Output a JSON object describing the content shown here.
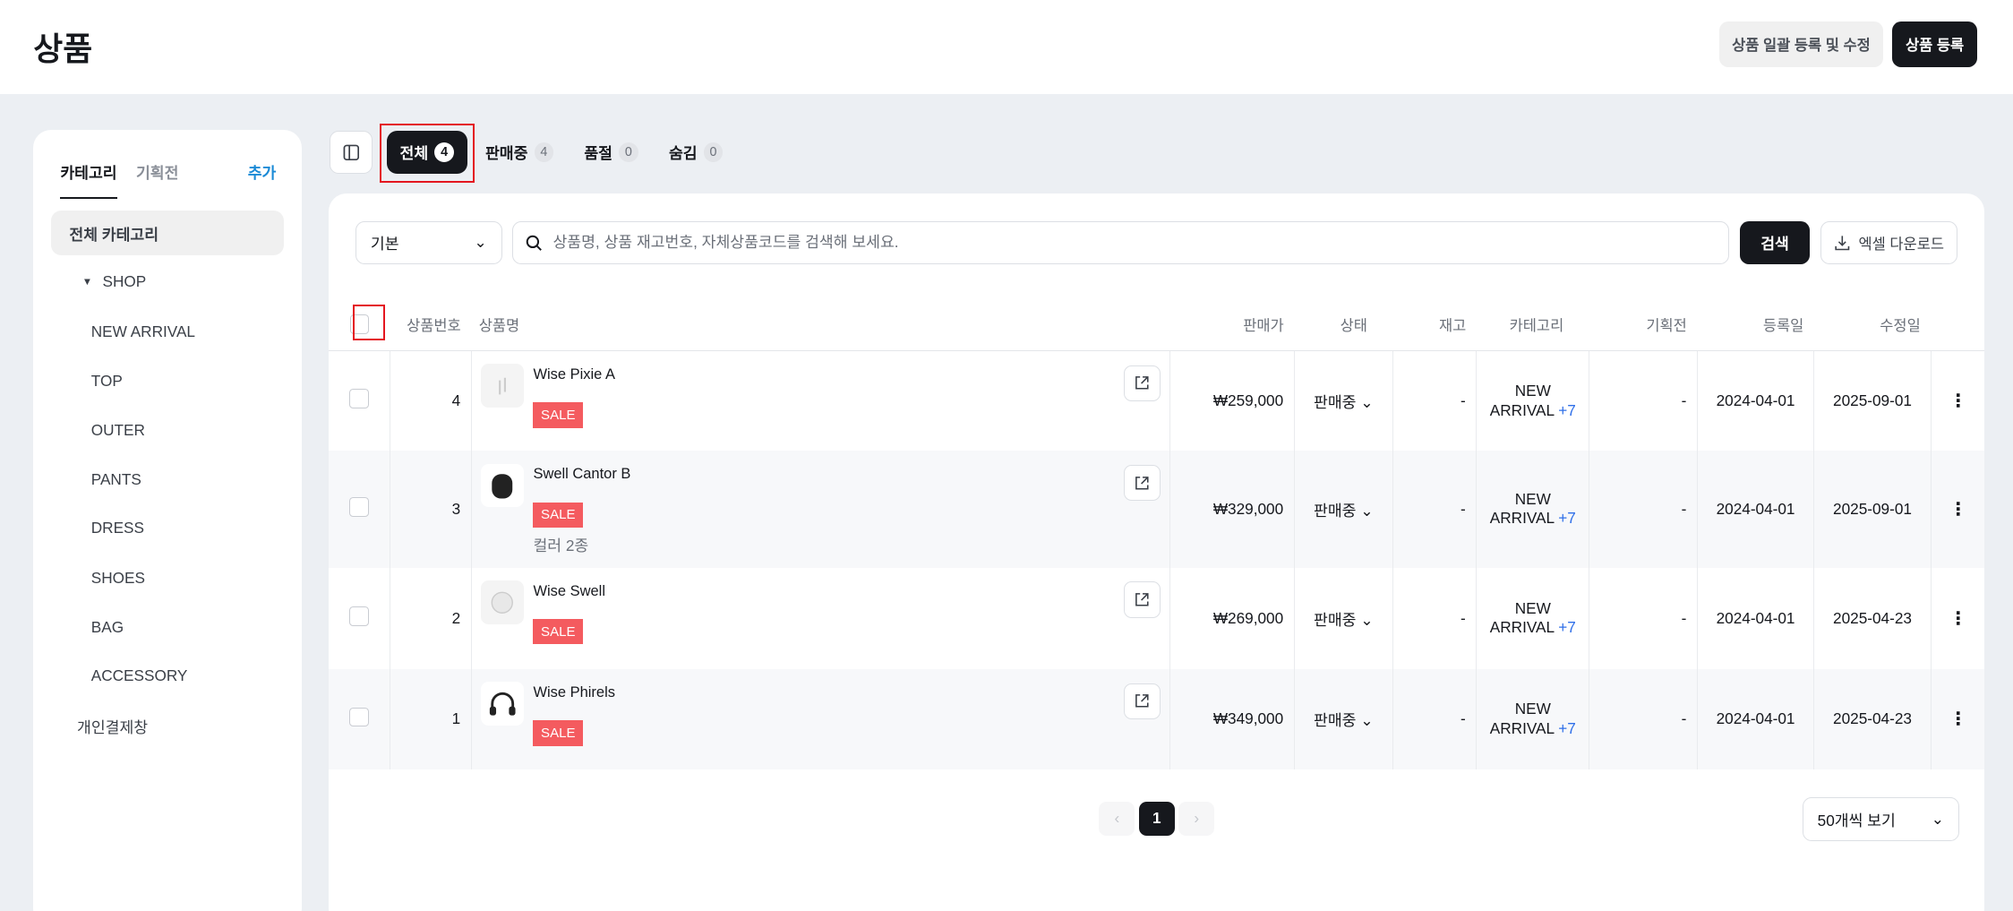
{
  "header": {
    "title": "상품",
    "bulk_button": "상품 일괄 등록 및 수정",
    "add_button": "상품 등록"
  },
  "sidebar": {
    "tabs": [
      "카테고리",
      "기획전"
    ],
    "add_link": "추가",
    "items": [
      {
        "label": "전체 카테고리"
      },
      {
        "label": "SHOP"
      },
      {
        "label": "NEW ARRIVAL"
      },
      {
        "label": "TOP"
      },
      {
        "label": "OUTER"
      },
      {
        "label": "PANTS"
      },
      {
        "label": "DRESS"
      },
      {
        "label": "SHOES"
      },
      {
        "label": "BAG"
      },
      {
        "label": "ACCESSORY"
      },
      {
        "label": "개인결제창"
      }
    ]
  },
  "tabs": [
    {
      "label": "전체",
      "count": "4"
    },
    {
      "label": "판매중",
      "count": "4"
    },
    {
      "label": "품절",
      "count": "0"
    },
    {
      "label": "숨김",
      "count": "0"
    }
  ],
  "filter": {
    "select": "기본",
    "search_placeholder": "상품명, 상품 재고번호, 자체상품코드를 검색해 보세요.",
    "search_button": "검색",
    "excel_button": "엑셀 다운로드"
  },
  "table": {
    "headers": [
      "상품번호",
      "상품명",
      "판매가",
      "상태",
      "재고",
      "카테고리",
      "기획전",
      "등록일",
      "수정일"
    ],
    "rows": [
      {
        "no": "4",
        "name": "Wise Pixie A",
        "badge": "SALE",
        "option": "",
        "price": "₩259,000",
        "status": "판매중",
        "stock": "-",
        "cat1": "NEW",
        "cat2": "ARRIVAL",
        "cat_more": "+7",
        "promo": "-",
        "created": "2024-04-01",
        "updated": "2025-09-01"
      },
      {
        "no": "3",
        "name": "Swell Cantor B",
        "badge": "SALE",
        "option": "컬러 2종",
        "price": "₩329,000",
        "status": "판매중",
        "stock": "-",
        "cat1": "NEW",
        "cat2": "ARRIVAL",
        "cat_more": "+7",
        "promo": "-",
        "created": "2024-04-01",
        "updated": "2025-09-01"
      },
      {
        "no": "2",
        "name": "Wise Swell",
        "badge": "SALE",
        "option": "",
        "price": "₩269,000",
        "status": "판매중",
        "stock": "-",
        "cat1": "NEW",
        "cat2": "ARRIVAL",
        "cat_more": "+7",
        "promo": "-",
        "created": "2024-04-01",
        "updated": "2025-04-23"
      },
      {
        "no": "1",
        "name": "Wise Phirels",
        "badge": "SALE",
        "option": "",
        "price": "₩349,000",
        "status": "판매중",
        "stock": "-",
        "cat1": "NEW",
        "cat2": "ARRIVAL",
        "cat_more": "+7",
        "promo": "-",
        "created": "2024-04-01",
        "updated": "2025-04-23"
      }
    ]
  },
  "pagination": {
    "current": "1",
    "per_page": "50개씩 보기"
  }
}
